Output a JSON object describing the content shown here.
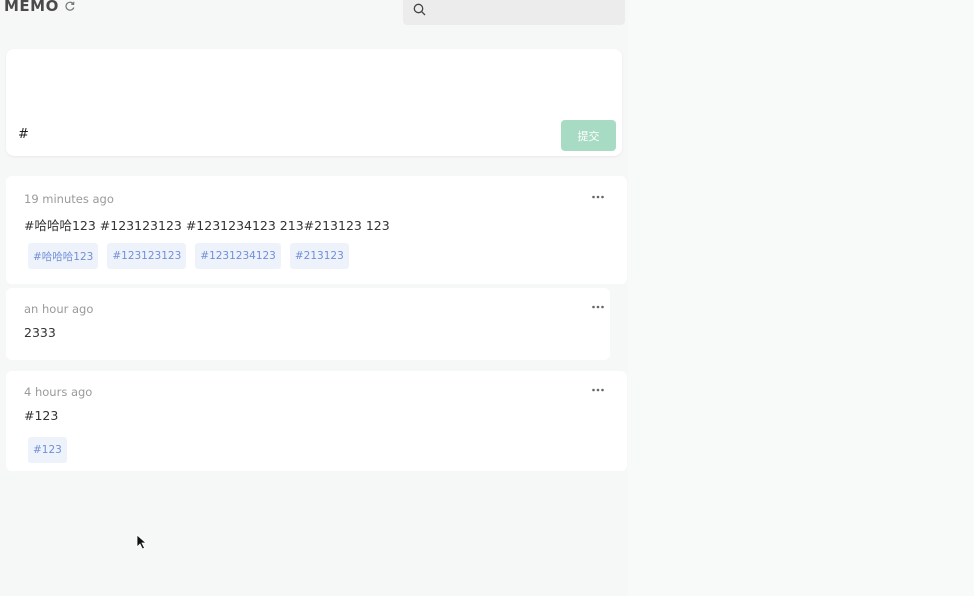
{
  "header": {
    "title": "MEMO",
    "search_placeholder": ""
  },
  "editor": {
    "text": "#",
    "submit_label": "提交"
  },
  "memos": [
    {
      "time": "19 minutes ago",
      "content": "#哈哈哈123 #123123123 #1231234123 213#213123 123",
      "tags": [
        "#哈哈哈123",
        "#123123123",
        "#1231234123",
        "#213123"
      ]
    },
    {
      "time": "an hour ago",
      "content": "2333",
      "tags": []
    },
    {
      "time": "4 hours ago",
      "content": "#123",
      "tags": [
        "#123"
      ]
    }
  ],
  "colors": {
    "background": "#f6f7f7",
    "card": "#ffffff",
    "tag_bg": "#eef2fb",
    "tag_text": "#6f8fd8",
    "submit_button": "#a8dbc3"
  },
  "icons": [
    "refresh-icon",
    "search-icon",
    "more-icon",
    "cursor-icon"
  ]
}
